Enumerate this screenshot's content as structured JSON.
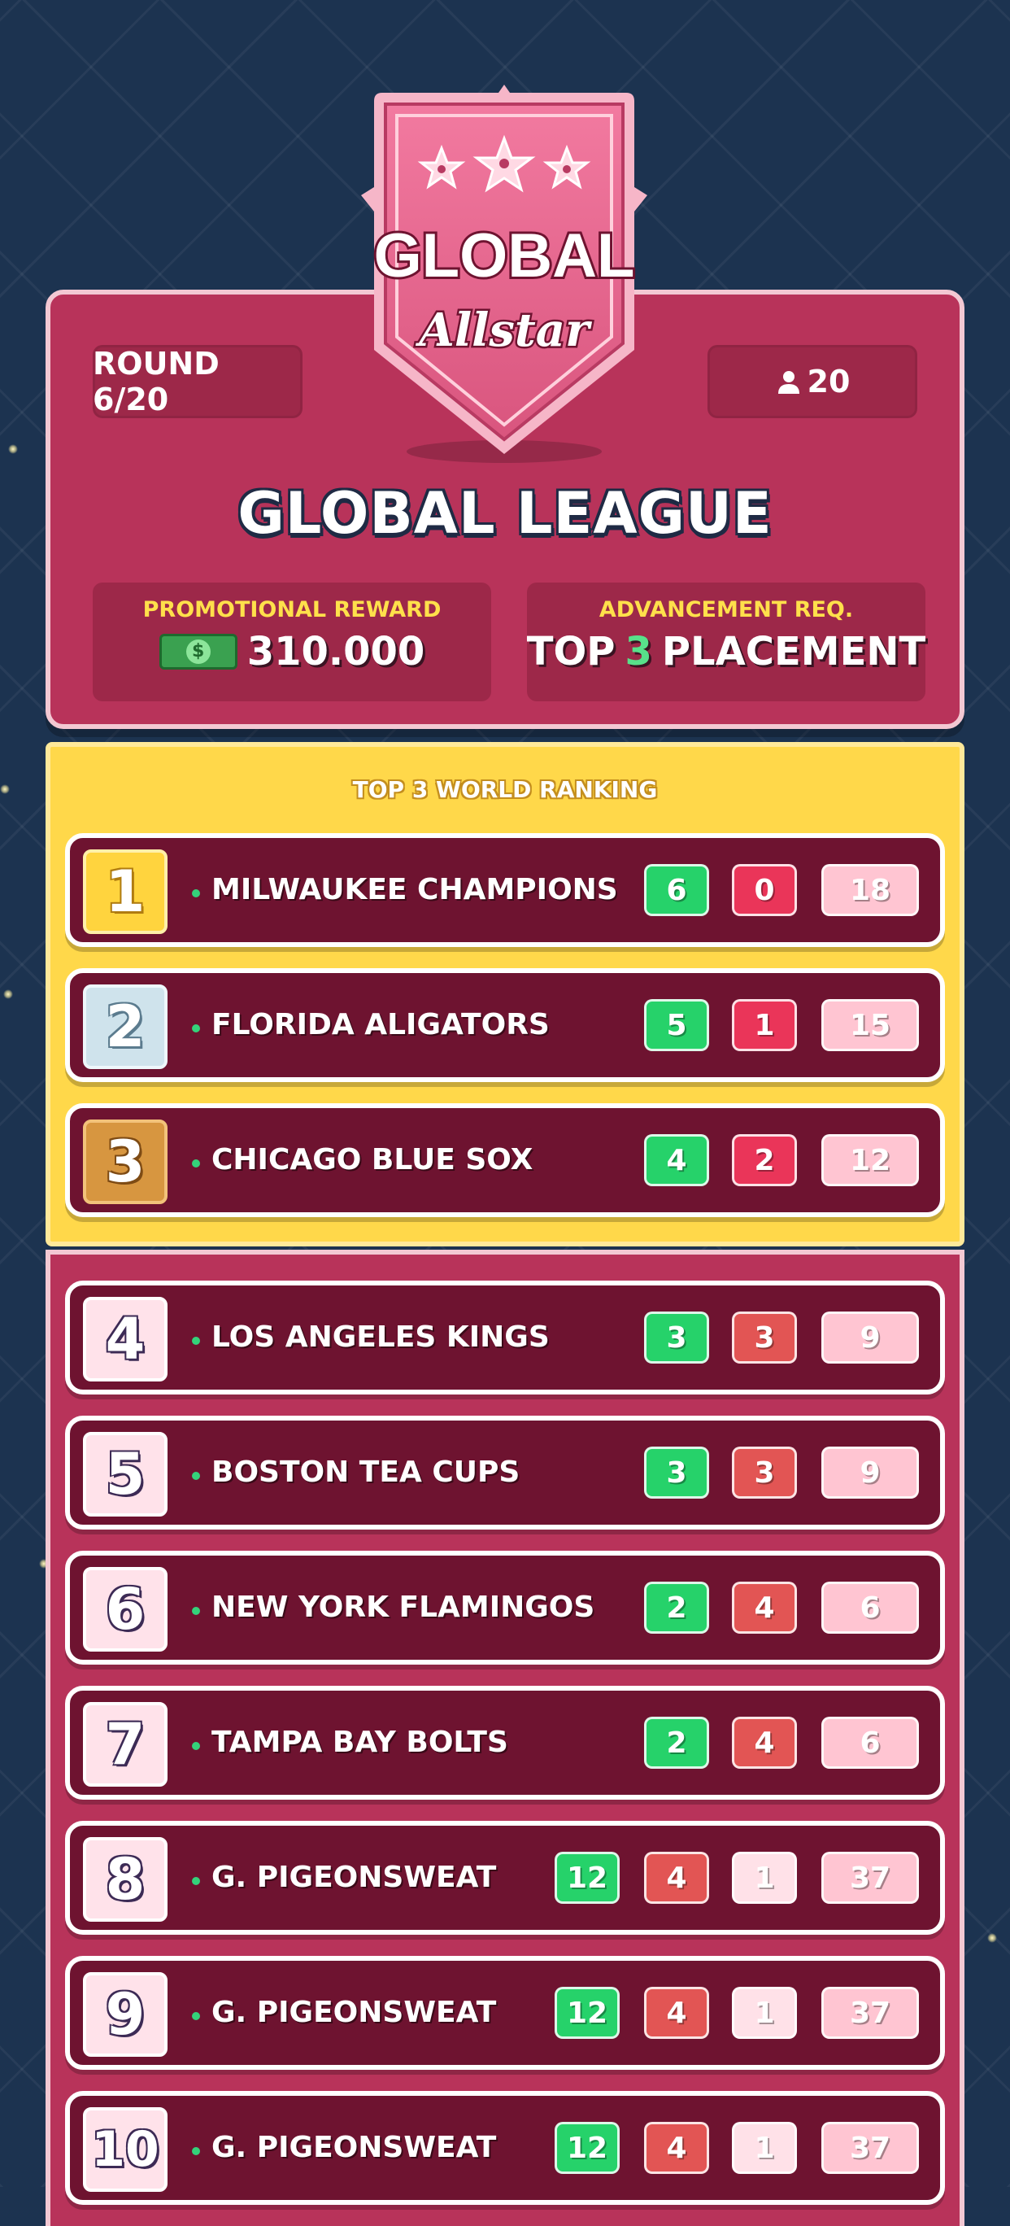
{
  "header": {
    "round": "ROUND 6/20",
    "players": "20",
    "league_title": "GLOBAL LEAGUE",
    "badge_line1": "GLOBAL",
    "badge_line2": "Allstar",
    "promotional_label": "PROMOTIONAL REWARD",
    "promotional_value": "310.000",
    "advancement_label": "ADVANCEMENT REQ.",
    "advancement_pre": "TOP",
    "advancement_num": "3",
    "advancement_post": "PLACEMENT"
  },
  "top_section_title": "TOP 3 WORLD RANKING",
  "rows": [
    {
      "rank": "1",
      "team": "MILWAUKEE CHAMPIONS",
      "wins": "6",
      "losses": "0",
      "points": "18"
    },
    {
      "rank": "2",
      "team": "FLORIDA ALIGATORS",
      "wins": "5",
      "losses": "1",
      "points": "15"
    },
    {
      "rank": "3",
      "team": "CHICAGO BLUE SOX",
      "wins": "4",
      "losses": "2",
      "points": "12"
    },
    {
      "rank": "4",
      "team": "LOS ANGELES KINGS",
      "wins": "3",
      "losses": "3",
      "points": "9"
    },
    {
      "rank": "5",
      "team": "BOSTON TEA CUPS",
      "wins": "3",
      "losses": "3",
      "points": "9"
    },
    {
      "rank": "6",
      "team": "NEW YORK FLAMINGOS",
      "wins": "2",
      "losses": "4",
      "points": "6"
    },
    {
      "rank": "7",
      "team": "TAMPA BAY BOLTS",
      "wins": "2",
      "losses": "4",
      "points": "6"
    },
    {
      "rank": "8",
      "team": "G. PIGEONSWEAT",
      "wins": "12",
      "losses": "4",
      "draws": "1",
      "points": "37"
    },
    {
      "rank": "9",
      "team": "G. PIGEONSWEAT",
      "wins": "12",
      "losses": "4",
      "draws": "1",
      "points": "37"
    },
    {
      "rank": "10",
      "team": "G. PIGEONSWEAT",
      "wins": "12",
      "losses": "4",
      "draws": "1",
      "points": "37"
    }
  ],
  "icons": {
    "players": "person-icon",
    "cash": "cash-icon",
    "stars": "star-icon"
  },
  "colors": {
    "gold": "#ffd43e",
    "crimson": "#b8335a",
    "row": "#6e1330",
    "win": "#26d26a",
    "loss": "#ea3559"
  }
}
